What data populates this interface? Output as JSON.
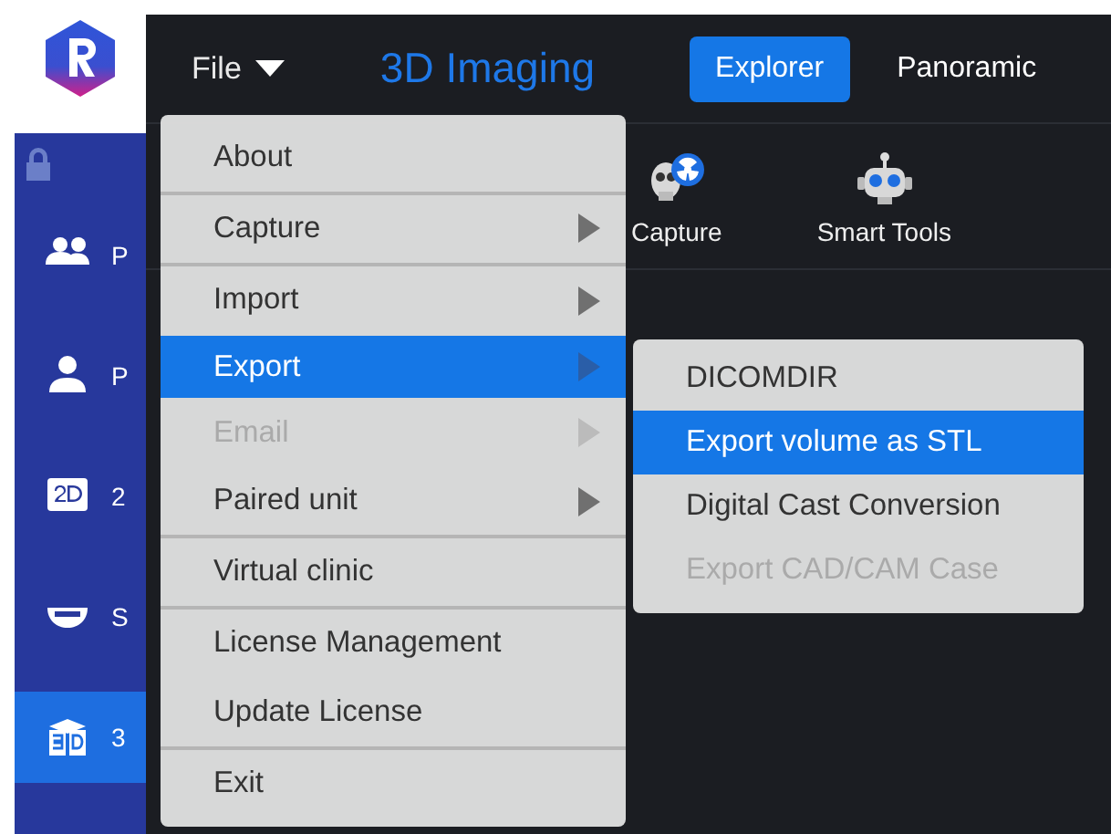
{
  "top_bar": {
    "file_menu": "File",
    "title": "3D Imaging",
    "tabs": [
      {
        "label": "Explorer",
        "selected": true
      },
      {
        "label": "Panoramic",
        "selected": false
      }
    ]
  },
  "sidebar": {
    "items": [
      {
        "kind": "patients",
        "label": "P",
        "selected": false
      },
      {
        "kind": "patient",
        "label": "P",
        "selected": false
      },
      {
        "kind": "planar",
        "label": "2",
        "selected": false
      },
      {
        "kind": "smile",
        "label": "S",
        "selected": false
      },
      {
        "kind": "volume",
        "label": "3",
        "selected": true
      }
    ]
  },
  "toolbar": [
    {
      "kind": "capture",
      "label": "Capture"
    },
    {
      "kind": "robot",
      "label": "Smart Tools"
    }
  ],
  "file_menu": {
    "items": [
      {
        "label": "About",
        "submenu": false,
        "disabled": false,
        "selected": false,
        "divider_below": true
      },
      {
        "label": "Capture",
        "submenu": true,
        "disabled": false,
        "selected": false,
        "divider_below": true
      },
      {
        "label": "Import",
        "submenu": true,
        "disabled": false,
        "selected": false,
        "divider_below": false
      },
      {
        "label": "Export",
        "submenu": true,
        "disabled": false,
        "selected": true,
        "divider_below": false
      },
      {
        "label": "Email",
        "submenu": true,
        "disabled": true,
        "selected": false,
        "divider_below": false
      },
      {
        "label": "Paired unit",
        "submenu": true,
        "disabled": false,
        "selected": false,
        "divider_below": true
      },
      {
        "label": "Virtual clinic",
        "submenu": false,
        "disabled": false,
        "selected": false,
        "divider_below": true
      },
      {
        "label": "License Management",
        "submenu": false,
        "disabled": false,
        "selected": false,
        "divider_below": false
      },
      {
        "label": "Update License",
        "submenu": false,
        "disabled": false,
        "selected": false,
        "divider_below": true
      },
      {
        "label": "Exit",
        "submenu": false,
        "disabled": false,
        "selected": false,
        "divider_below": false
      }
    ]
  },
  "export_submenu": {
    "items": [
      {
        "label": "DICOMDIR",
        "disabled": false,
        "selected": false
      },
      {
        "label": "Export volume as STL",
        "disabled": false,
        "selected": true
      },
      {
        "label": "Digital Cast Conversion",
        "disabled": false,
        "selected": false
      },
      {
        "label": "Export CAD/CAM Case",
        "disabled": true,
        "selected": false
      }
    ]
  }
}
